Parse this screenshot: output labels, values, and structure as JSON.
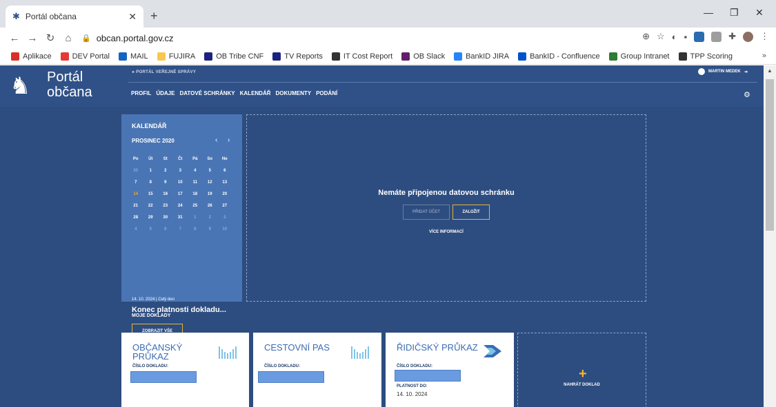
{
  "browser": {
    "tab_title": "Portál občana",
    "url": "obcan.portal.gov.cz",
    "bookmarks": [
      {
        "label": "Aplikace",
        "icon": "apps-grid-icon",
        "color": "#d93025"
      },
      {
        "label": "DEV Portal",
        "icon": "bookmark-icon",
        "color": "#e53935"
      },
      {
        "label": "MAIL",
        "icon": "outlook-icon",
        "color": "#1565c0"
      },
      {
        "label": "FUJIRA",
        "icon": "folder-icon",
        "color": "#f9c74f"
      },
      {
        "label": "OB Tribe CNF",
        "icon": "wiki-icon",
        "color": "#1a237e"
      },
      {
        "label": "TV Reports",
        "icon": "wiki-icon",
        "color": "#1a237e"
      },
      {
        "label": "IT Cost Report",
        "icon": "globe-icon",
        "color": "#333333"
      },
      {
        "label": "OB Slack",
        "icon": "slack-icon",
        "color": "#611f69"
      },
      {
        "label": "BankID JIRA",
        "icon": "jira-icon",
        "color": "#2684ff"
      },
      {
        "label": "BankID - Confluence",
        "icon": "confluence-icon",
        "color": "#0052cc"
      },
      {
        "label": "Group Intranet",
        "icon": "intranet-icon",
        "color": "#2e7d32"
      },
      {
        "label": "TPP Scoring",
        "icon": "globe-icon",
        "color": "#333333"
      }
    ]
  },
  "header": {
    "logo_line1": "Portál",
    "logo_line2": "občana",
    "gov_link": "▸ PORTÁL VEŘEJNÉ SPRÁVY",
    "user": "MARTIN MEDEK",
    "nav": [
      "PROFIL",
      "ÚDAJE",
      "DATOVÉ SCHRÁNKY",
      "KALENDÁŘ",
      "DOKUMENTY",
      "PODÁNÍ"
    ]
  },
  "calendar": {
    "title": "KALENDÁŘ",
    "month": "PROSINEC 2020",
    "weekdays": [
      "Po",
      "Út",
      "St",
      "Čt",
      "Pá",
      "So",
      "Ne"
    ],
    "weeks": [
      [
        "30",
        "1",
        "2",
        "3",
        "4",
        "5",
        "6"
      ],
      [
        "7",
        "8",
        "9",
        "10",
        "11",
        "12",
        "13"
      ],
      [
        "14",
        "15",
        "16",
        "17",
        "18",
        "19",
        "20"
      ],
      [
        "21",
        "22",
        "23",
        "24",
        "25",
        "26",
        "27"
      ],
      [
        "28",
        "29",
        "30",
        "31",
        "1",
        "2",
        "3"
      ],
      [
        "4",
        "5",
        "6",
        "7",
        "8",
        "9",
        "10"
      ]
    ],
    "event_meta": "14. 10. 2024 | Celý den",
    "event_title": "Konec platnosti dokladu...",
    "show_all": "ZOBRAZIT VŠE"
  },
  "databox": {
    "message": "Nemáte připojenou datovou schránku",
    "add_account": "PŘIDAT ÚČET",
    "create": "ZALOŽIT",
    "more_info": "VÍCE INFORMACÍ"
  },
  "documents": {
    "section_title": "MOJE DOKLADY",
    "cards": [
      {
        "title": "OBČANSKÝ PRŮKAZ",
        "number_label": "ČÍSLO DOKLADU:"
      },
      {
        "title": "CESTOVNÍ PAS",
        "number_label": "ČÍSLO DOKLADU:"
      },
      {
        "title": "ŘIDIČSKÝ PRŮKAZ",
        "number_label": "ČÍSLO DOKLADU:",
        "validity_label": "PLATNOST DO:",
        "validity_value": "14. 10. 2024"
      }
    ],
    "upload_label": "NAHRÁT DOKLAD"
  },
  "colors": {
    "page_bg": "#2d4d80",
    "header_bg": "#2f5187",
    "calendar_bg": "#4a75b5",
    "accent": "#e6b53c",
    "card_title": "#3a6cb4"
  }
}
